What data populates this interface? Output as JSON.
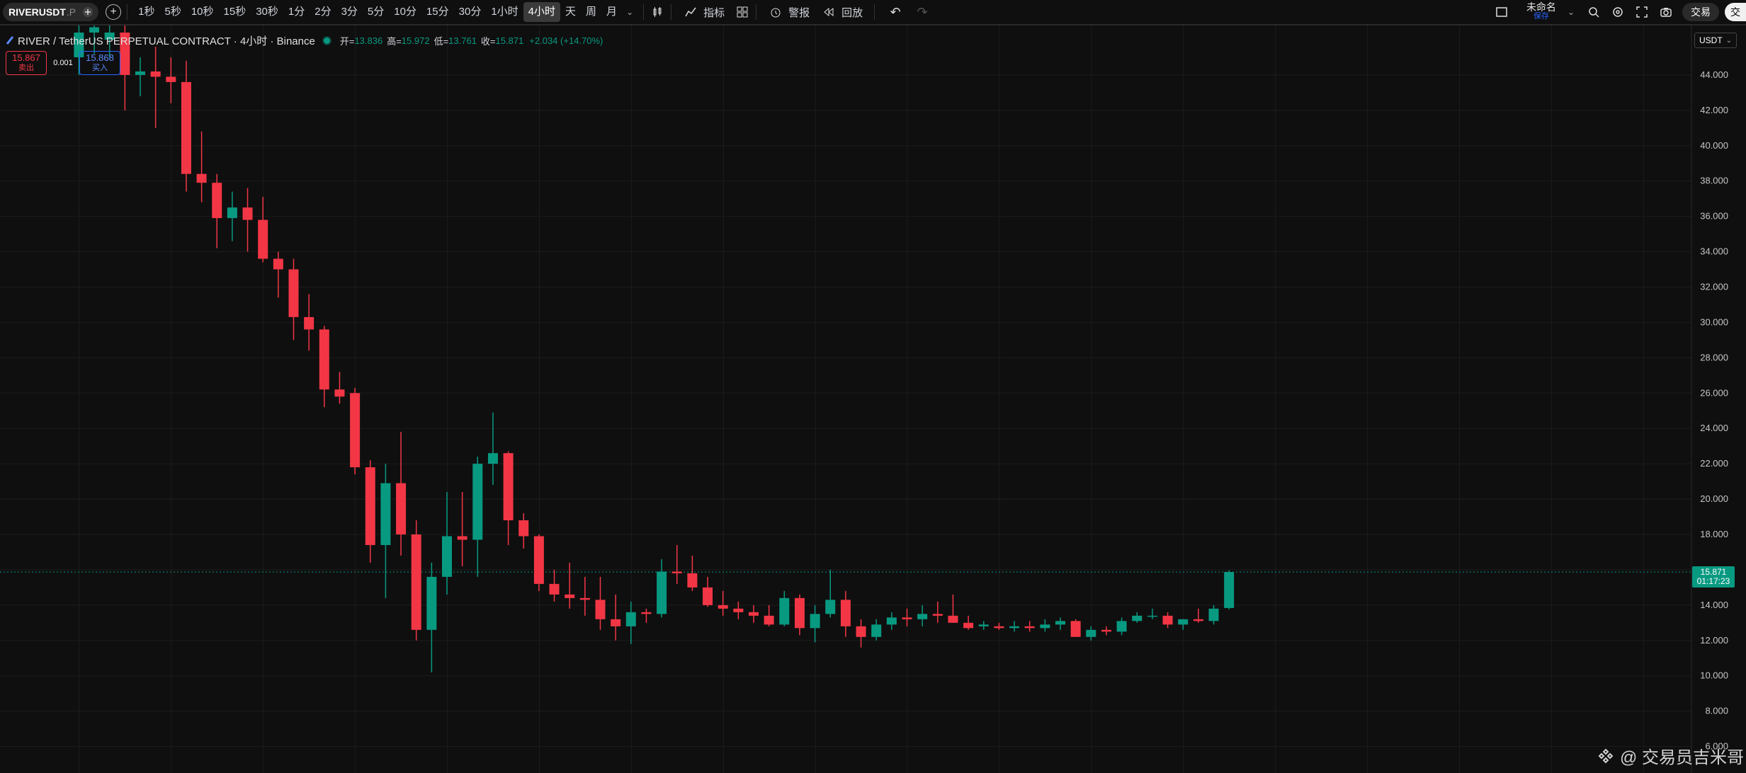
{
  "toolbar": {
    "symbol": "RIVERUSDT",
    "symbol_suffix": ".P",
    "timeframes": [
      "1秒",
      "5秒",
      "10秒",
      "15秒",
      "30秒",
      "1分",
      "2分",
      "3分",
      "5分",
      "10分",
      "15分",
      "30分",
      "1小时",
      "4小时",
      "天",
      "周",
      "月"
    ],
    "active_timeframe": "4小时",
    "indicators_label": "指标",
    "alerts_label": "警报",
    "replay_label": "回放",
    "layout_name": "未命名",
    "layout_status": "保存",
    "trade_label": "交易",
    "avatar_letter": "交"
  },
  "legend": {
    "title": "RIVER / TetherUS PERPETUAL CONTRACT · 4小时 · Binance",
    "open_label": "开=",
    "open": "13.836",
    "high_label": "高=",
    "high": "15.972",
    "low_label": "低=",
    "low": "13.761",
    "close_label": "收=",
    "close": "15.871",
    "change": "+2.034 (+14.70%)"
  },
  "trade_boxes": {
    "sell_price": "15.867",
    "sell_label": "卖出",
    "spread": "0.001",
    "buy_price": "15.868",
    "buy_label": "买入"
  },
  "price_scale": {
    "currency": "USDT",
    "last_price": "15.871",
    "countdown": "01:17:23"
  },
  "watermark": "@ 交易员吉米哥",
  "colors": {
    "up": "#089981",
    "down": "#f23645",
    "background": "#0f0f0f",
    "grid": "#1c1c1c"
  },
  "chart_data": {
    "type": "candlestick",
    "y_ticks": [
      "6.000",
      "8.000",
      "10.000",
      "12.000",
      "14.000",
      "16.000",
      "18.000",
      "20.000",
      "22.000",
      "24.000",
      "26.000",
      "28.000",
      "30.000",
      "32.000",
      "34.000",
      "36.000",
      "38.000",
      "40.000",
      "42.000",
      "44.000"
    ],
    "ylim": [
      4.5,
      46.8
    ],
    "last_price": 15.871,
    "candles": [
      {
        "o": 45.0,
        "h": 47.0,
        "l": 44.0,
        "c": 46.4
      },
      {
        "o": 46.4,
        "h": 47.0,
        "l": 45.2,
        "c": 46.7
      },
      {
        "o": 46.0,
        "h": 47.0,
        "l": 45.0,
        "c": 46.4
      },
      {
        "o": 46.4,
        "h": 47.0,
        "l": 42.0,
        "c": 44.0
      },
      {
        "o": 44.0,
        "h": 45.0,
        "l": 42.8,
        "c": 44.2
      },
      {
        "o": 44.2,
        "h": 45.6,
        "l": 41.0,
        "c": 43.9
      },
      {
        "o": 43.9,
        "h": 45.0,
        "l": 42.4,
        "c": 43.6
      },
      {
        "o": 43.6,
        "h": 44.8,
        "l": 37.4,
        "c": 38.4
      },
      {
        "o": 38.4,
        "h": 40.8,
        "l": 36.8,
        "c": 37.9
      },
      {
        "o": 37.9,
        "h": 38.4,
        "l": 34.2,
        "c": 35.9
      },
      {
        "o": 35.9,
        "h": 37.4,
        "l": 34.6,
        "c": 36.5
      },
      {
        "o": 36.5,
        "h": 37.6,
        "l": 34.0,
        "c": 35.8
      },
      {
        "o": 35.8,
        "h": 37.1,
        "l": 33.4,
        "c": 33.6
      },
      {
        "o": 33.6,
        "h": 34.0,
        "l": 31.4,
        "c": 33.0
      },
      {
        "o": 33.0,
        "h": 33.6,
        "l": 29.0,
        "c": 30.3
      },
      {
        "o": 30.3,
        "h": 31.6,
        "l": 28.4,
        "c": 29.6
      },
      {
        "o": 29.6,
        "h": 29.8,
        "l": 25.2,
        "c": 26.2
      },
      {
        "o": 26.2,
        "h": 27.2,
        "l": 25.4,
        "c": 25.8
      },
      {
        "o": 26.0,
        "h": 26.3,
        "l": 21.4,
        "c": 21.8
      },
      {
        "o": 21.8,
        "h": 22.2,
        "l": 16.4,
        "c": 17.4
      },
      {
        "o": 17.4,
        "h": 22.0,
        "l": 14.4,
        "c": 20.9
      },
      {
        "o": 20.9,
        "h": 23.8,
        "l": 16.8,
        "c": 18.0
      },
      {
        "o": 18.0,
        "h": 18.8,
        "l": 12.0,
        "c": 12.6
      },
      {
        "o": 12.6,
        "h": 16.4,
        "l": 10.2,
        "c": 15.6
      },
      {
        "o": 15.6,
        "h": 20.4,
        "l": 14.6,
        "c": 17.9
      },
      {
        "o": 17.9,
        "h": 20.4,
        "l": 16.2,
        "c": 17.7
      },
      {
        "o": 17.7,
        "h": 22.4,
        "l": 15.6,
        "c": 22.0
      },
      {
        "o": 22.0,
        "h": 24.9,
        "l": 20.8,
        "c": 22.6
      },
      {
        "o": 22.6,
        "h": 22.7,
        "l": 17.4,
        "c": 18.8
      },
      {
        "o": 18.8,
        "h": 19.2,
        "l": 17.2,
        "c": 17.9
      },
      {
        "o": 17.9,
        "h": 18.0,
        "l": 14.8,
        "c": 15.2
      },
      {
        "o": 15.2,
        "h": 16.0,
        "l": 14.2,
        "c": 14.6
      },
      {
        "o": 14.6,
        "h": 16.4,
        "l": 13.8,
        "c": 14.4
      },
      {
        "o": 14.4,
        "h": 15.6,
        "l": 13.4,
        "c": 14.3
      },
      {
        "o": 14.3,
        "h": 15.6,
        "l": 12.6,
        "c": 13.2
      },
      {
        "o": 13.2,
        "h": 14.6,
        "l": 12.0,
        "c": 12.8
      },
      {
        "o": 12.8,
        "h": 14.2,
        "l": 11.8,
        "c": 13.6
      },
      {
        "o": 13.6,
        "h": 13.8,
        "l": 13.0,
        "c": 13.5
      },
      {
        "o": 13.5,
        "h": 16.6,
        "l": 13.3,
        "c": 15.9
      },
      {
        "o": 15.9,
        "h": 17.4,
        "l": 15.2,
        "c": 15.8
      },
      {
        "o": 15.8,
        "h": 16.8,
        "l": 14.8,
        "c": 15.0
      },
      {
        "o": 15.0,
        "h": 15.6,
        "l": 13.9,
        "c": 14.0
      },
      {
        "o": 14.0,
        "h": 14.8,
        "l": 13.4,
        "c": 13.8
      },
      {
        "o": 13.8,
        "h": 14.2,
        "l": 13.2,
        "c": 13.6
      },
      {
        "o": 13.6,
        "h": 14.0,
        "l": 13.0,
        "c": 13.4
      },
      {
        "o": 13.4,
        "h": 14.0,
        "l": 12.8,
        "c": 12.9
      },
      {
        "o": 12.9,
        "h": 14.8,
        "l": 12.8,
        "c": 14.4
      },
      {
        "o": 14.4,
        "h": 14.6,
        "l": 12.3,
        "c": 12.7
      },
      {
        "o": 12.7,
        "h": 14.0,
        "l": 11.9,
        "c": 13.5
      },
      {
        "o": 13.5,
        "h": 16.0,
        "l": 13.3,
        "c": 14.3
      },
      {
        "o": 14.3,
        "h": 14.8,
        "l": 12.2,
        "c": 12.8
      },
      {
        "o": 12.8,
        "h": 13.2,
        "l": 11.6,
        "c": 12.2
      },
      {
        "o": 12.2,
        "h": 13.2,
        "l": 12.0,
        "c": 12.9
      },
      {
        "o": 12.9,
        "h": 13.6,
        "l": 12.6,
        "c": 13.3
      },
      {
        "o": 13.3,
        "h": 13.8,
        "l": 12.8,
        "c": 13.2
      },
      {
        "o": 13.2,
        "h": 14.0,
        "l": 12.8,
        "c": 13.5
      },
      {
        "o": 13.5,
        "h": 14.2,
        "l": 13.0,
        "c": 13.4
      },
      {
        "o": 13.4,
        "h": 14.6,
        "l": 13.0,
        "c": 13.0
      },
      {
        "o": 13.0,
        "h": 13.4,
        "l": 12.6,
        "c": 12.7
      },
      {
        "o": 12.8,
        "h": 13.1,
        "l": 12.6,
        "c": 12.9
      },
      {
        "o": 12.8,
        "h": 13.0,
        "l": 12.6,
        "c": 12.7
      },
      {
        "o": 12.7,
        "h": 13.1,
        "l": 12.5,
        "c": 12.8
      },
      {
        "o": 12.8,
        "h": 13.1,
        "l": 12.5,
        "c": 12.7
      },
      {
        "o": 12.7,
        "h": 13.2,
        "l": 12.5,
        "c": 12.9
      },
      {
        "o": 12.9,
        "h": 13.3,
        "l": 12.6,
        "c": 13.1
      },
      {
        "o": 13.1,
        "h": 13.2,
        "l": 12.2,
        "c": 12.2
      },
      {
        "o": 12.2,
        "h": 12.8,
        "l": 12.0,
        "c": 12.6
      },
      {
        "o": 12.6,
        "h": 12.8,
        "l": 12.3,
        "c": 12.5
      },
      {
        "o": 12.5,
        "h": 13.3,
        "l": 12.3,
        "c": 13.1
      },
      {
        "o": 13.1,
        "h": 13.6,
        "l": 13.0,
        "c": 13.4
      },
      {
        "o": 13.4,
        "h": 13.8,
        "l": 13.2,
        "c": 13.4
      },
      {
        "o": 13.4,
        "h": 13.6,
        "l": 12.7,
        "c": 12.9
      },
      {
        "o": 12.9,
        "h": 13.2,
        "l": 12.6,
        "c": 13.2
      },
      {
        "o": 13.2,
        "h": 13.8,
        "l": 13.0,
        "c": 13.1
      },
      {
        "o": 13.1,
        "h": 14.0,
        "l": 12.9,
        "c": 13.8
      },
      {
        "o": 13.836,
        "h": 15.972,
        "l": 13.761,
        "c": 15.871
      }
    ]
  }
}
